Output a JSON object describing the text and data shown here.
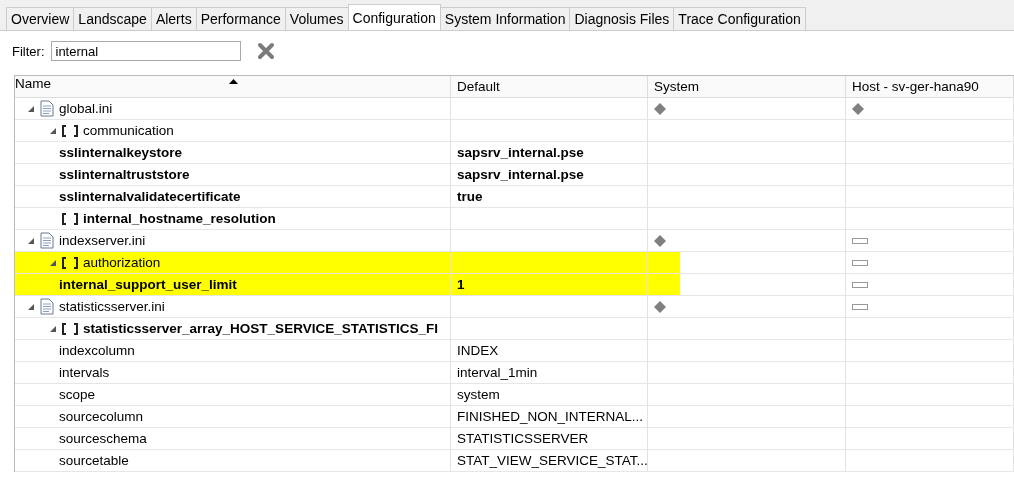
{
  "tabs": [
    {
      "label": "Overview",
      "selected": false
    },
    {
      "label": "Landscape",
      "selected": false
    },
    {
      "label": "Alerts",
      "selected": false
    },
    {
      "label": "Performance",
      "selected": false
    },
    {
      "label": "Volumes",
      "selected": false
    },
    {
      "label": "Configuration",
      "selected": true
    },
    {
      "label": "System Information",
      "selected": false
    },
    {
      "label": "Diagnosis Files",
      "selected": false
    },
    {
      "label": "Trace Configuration",
      "selected": false
    }
  ],
  "filter": {
    "label": "Filter:",
    "value": "internal"
  },
  "table": {
    "columns": [
      "Name",
      "Default",
      "System",
      "Host - sv-ger-hana90"
    ],
    "rows": [
      {
        "kind": "file",
        "name": "global.ini",
        "expanded": true,
        "bold": false,
        "highlighted": false,
        "system": {
          "kind": "diamond"
        },
        "host": {
          "kind": "diamond"
        },
        "children": [
          {
            "kind": "section",
            "name": "communication",
            "expanded": true,
            "bold": false,
            "highlighted": false,
            "children": [
              {
                "kind": "param",
                "name": "sslinternalkeystore",
                "default": "sapsrv_internal.pse",
                "bold": true,
                "highlighted": false
              },
              {
                "kind": "param",
                "name": "sslinternaltruststore",
                "default": "sapsrv_internal.pse",
                "bold": true,
                "highlighted": false
              },
              {
                "kind": "param",
                "name": "sslinternalvalidatecertificate",
                "default": "true",
                "bold": true,
                "highlighted": false
              }
            ]
          },
          {
            "kind": "section",
            "name": "internal_hostname_resolution",
            "expanded": false,
            "bold": true,
            "highlighted": false
          }
        ]
      },
      {
        "kind": "file",
        "name": "indexserver.ini",
        "expanded": true,
        "bold": false,
        "highlighted": false,
        "system": {
          "kind": "diamond"
        },
        "host": {
          "kind": "dash"
        },
        "children": [
          {
            "kind": "section",
            "name": "authorization",
            "expanded": true,
            "bold": false,
            "highlighted": true,
            "host": {
              "kind": "dash"
            },
            "children": [
              {
                "kind": "param",
                "name": "internal_support_user_limit",
                "default": "1",
                "bold": true,
                "highlighted": true,
                "host": {
                  "kind": "dash"
                }
              }
            ]
          }
        ]
      },
      {
        "kind": "file",
        "name": "statisticsserver.ini",
        "expanded": true,
        "bold": false,
        "highlighted": false,
        "system": {
          "kind": "diamond"
        },
        "host": {
          "kind": "dash"
        },
        "children": [
          {
            "kind": "section",
            "name": "statisticsserver_array_HOST_SERVICE_STATISTICS_FI",
            "expanded": true,
            "bold": true,
            "highlighted": false,
            "children": [
              {
                "kind": "param",
                "name": "indexcolumn",
                "default": "INDEX",
                "bold": false,
                "highlighted": false
              },
              {
                "kind": "param",
                "name": "intervals",
                "default": "interval_1min",
                "bold": false,
                "highlighted": false
              },
              {
                "kind": "param",
                "name": "scope",
                "default": "system",
                "bold": false,
                "highlighted": false
              },
              {
                "kind": "param",
                "name": "sourcecolumn",
                "default": "FINISHED_NON_INTERNAL...",
                "bold": false,
                "highlighted": false
              },
              {
                "kind": "param",
                "name": "sourceschema",
                "default": "STATISTICSSERVER",
                "bold": false,
                "highlighted": false
              },
              {
                "kind": "param",
                "name": "sourcetable",
                "default": "STAT_VIEW_SERVICE_STAT...",
                "bold": false,
                "highlighted": false
              }
            ]
          }
        ]
      }
    ]
  }
}
